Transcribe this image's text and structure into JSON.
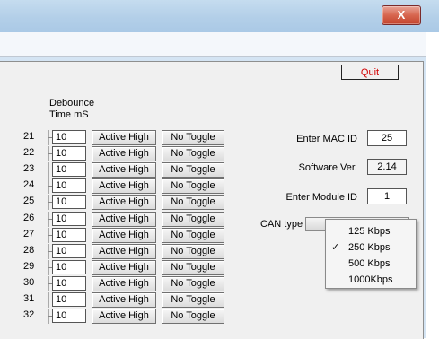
{
  "window": {
    "close_glyph": "X"
  },
  "toolbar": {
    "quit_label": "Quit"
  },
  "grid": {
    "header_line1": "Debounce",
    "header_line2": "Time mS",
    "rows": [
      {
        "num": "21",
        "value": "10",
        "polarity": "Active High",
        "toggle": "No Toggle"
      },
      {
        "num": "22",
        "value": "10",
        "polarity": "Active High",
        "toggle": "No Toggle"
      },
      {
        "num": "23",
        "value": "10",
        "polarity": "Active High",
        "toggle": "No Toggle"
      },
      {
        "num": "24",
        "value": "10",
        "polarity": "Active High",
        "toggle": "No Toggle"
      },
      {
        "num": "25",
        "value": "10",
        "polarity": "Active High",
        "toggle": "No Toggle"
      },
      {
        "num": "26",
        "value": "10",
        "polarity": "Active High",
        "toggle": "No Toggle"
      },
      {
        "num": "27",
        "value": "10",
        "polarity": "Active High",
        "toggle": "No Toggle"
      },
      {
        "num": "28",
        "value": "10",
        "polarity": "Active High",
        "toggle": "No Toggle"
      },
      {
        "num": "29",
        "value": "10",
        "polarity": "Active High",
        "toggle": "No Toggle"
      },
      {
        "num": "30",
        "value": "10",
        "polarity": "Active High",
        "toggle": "No Toggle"
      },
      {
        "num": "31",
        "value": "10",
        "polarity": "Active High",
        "toggle": "No Toggle"
      },
      {
        "num": "32",
        "value": "10",
        "polarity": "Active High",
        "toggle": "No Toggle"
      }
    ]
  },
  "settings": {
    "mac_label": "Enter MAC ID",
    "mac_value": "25",
    "sw_label": "Software Ver.",
    "sw_value": "2.14",
    "module_label": "Enter Module ID",
    "module_value": "1",
    "can_label": "CAN type"
  },
  "can_menu": {
    "check_glyph": "✓",
    "items": [
      {
        "label": "125 Kbps",
        "checked": false
      },
      {
        "label": "250 Kbps",
        "checked": true
      },
      {
        "label": "500 Kbps",
        "checked": false
      },
      {
        "label": "1000Kbps",
        "checked": false
      }
    ]
  }
}
